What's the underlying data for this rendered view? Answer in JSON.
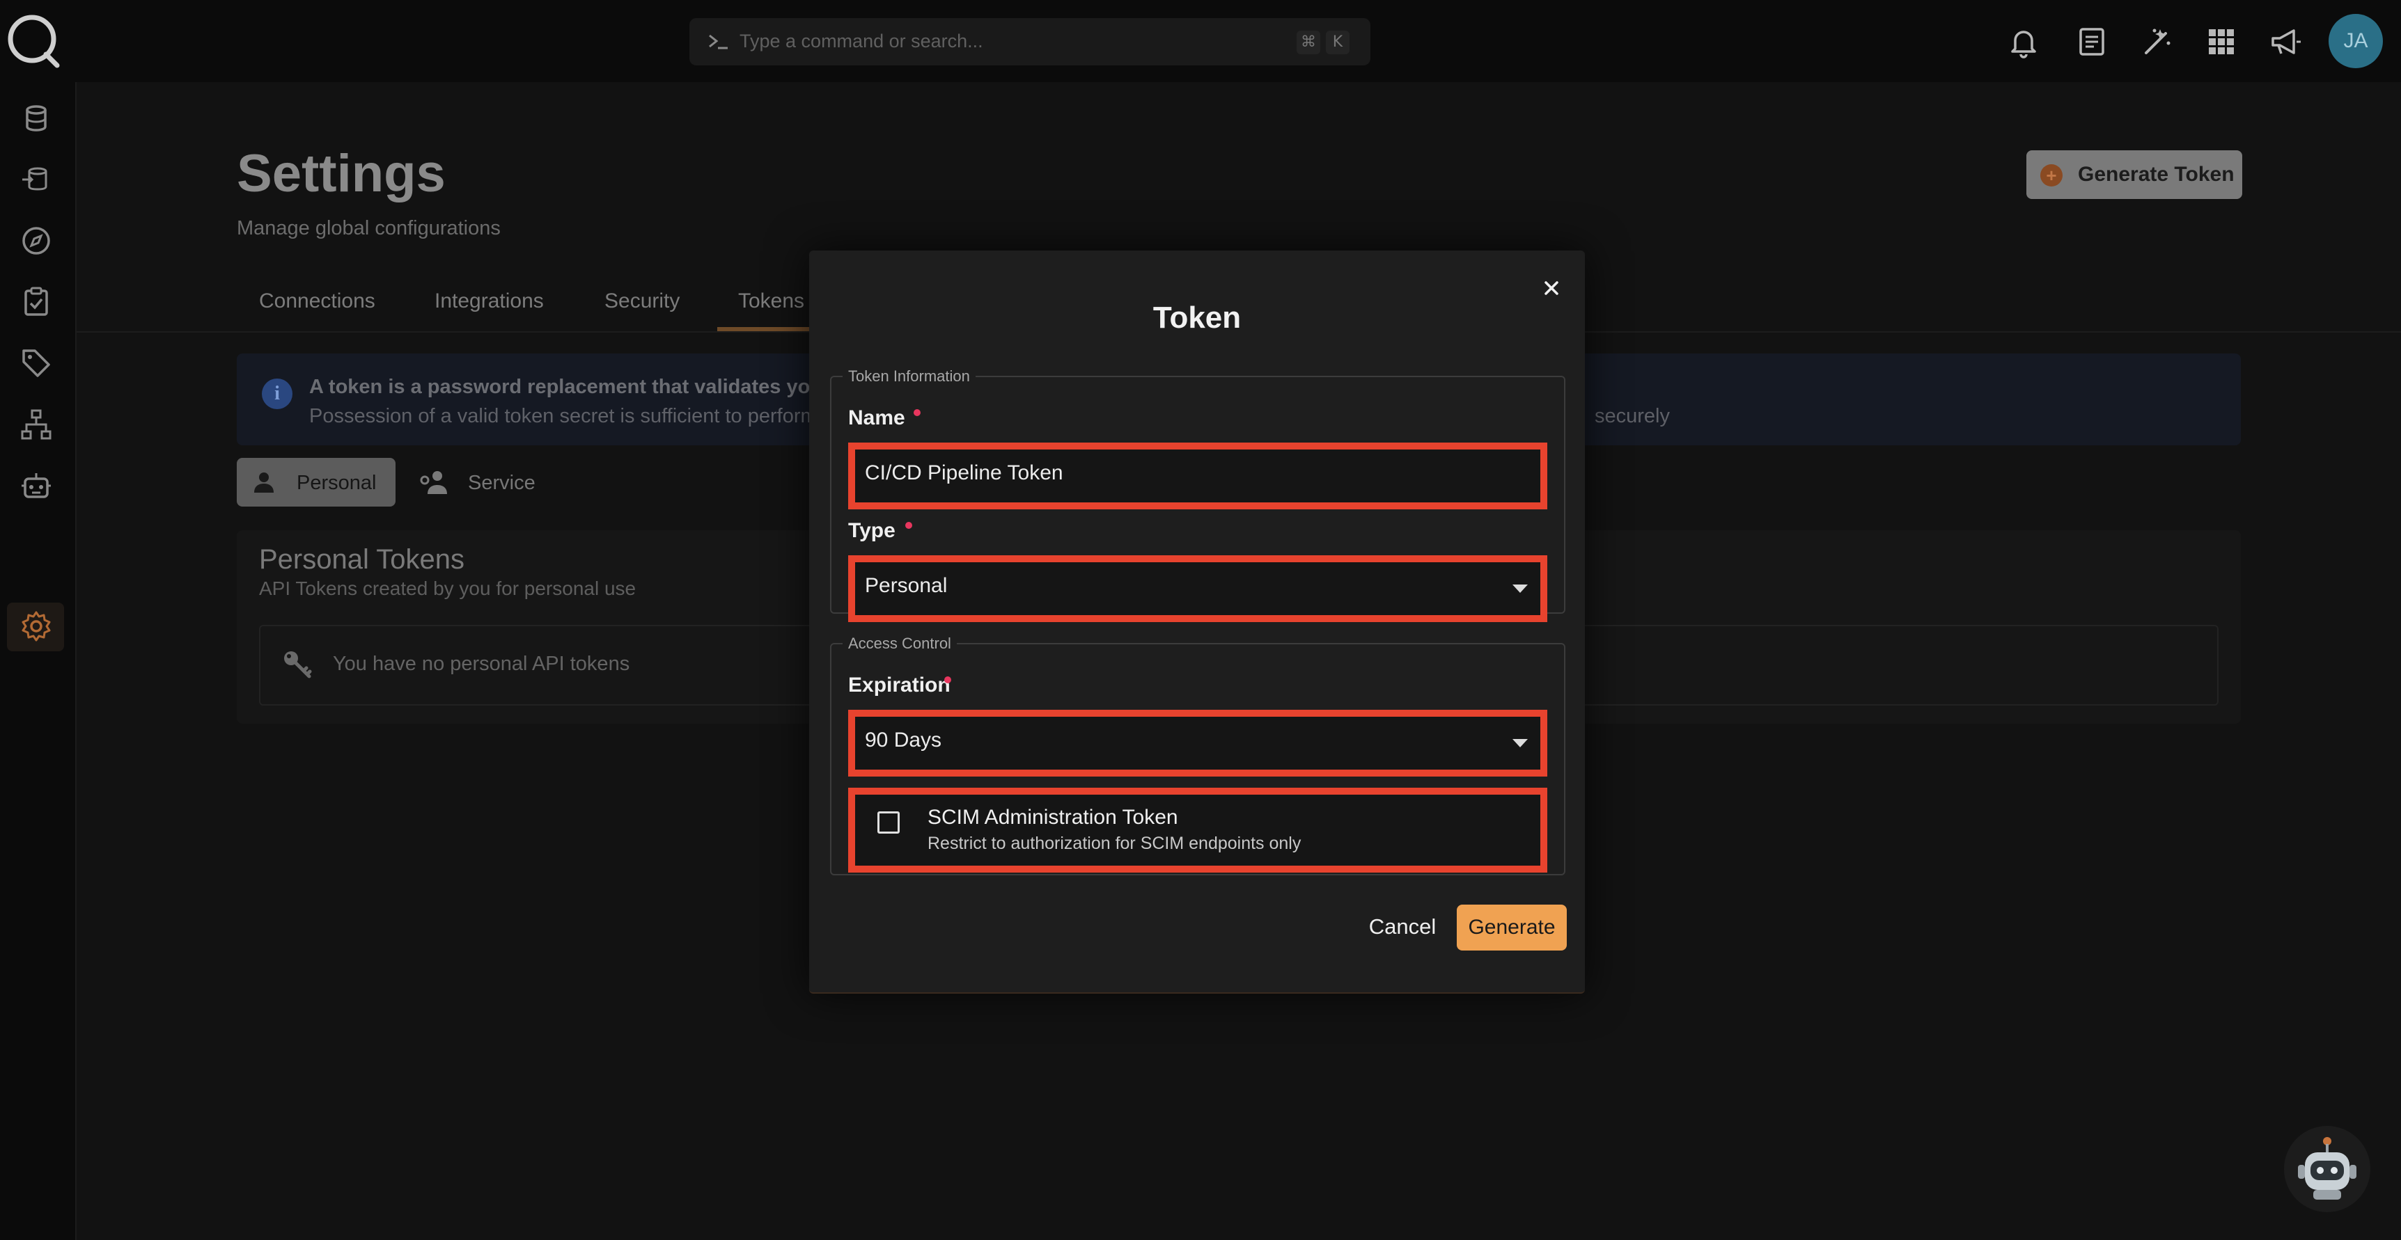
{
  "search": {
    "placeholder": "Type a command or search...",
    "shortcut_keys": [
      "⌘",
      "K"
    ]
  },
  "user": {
    "initials": "JA"
  },
  "page": {
    "title": "Settings",
    "subtitle": "Manage global configurations",
    "generate_token_label": "Generate Token",
    "tabs": [
      "Connections",
      "Integrations",
      "Security",
      "Tokens"
    ],
    "active_tab": "Tokens",
    "info": {
      "line1": "A token is a password replacement that validates you",
      "line2": "Possession of a valid token secret is sufficient to perform",
      "line2_tail": "securely"
    },
    "segments": {
      "personal": "Personal",
      "service": "Service"
    },
    "personal_tokens": {
      "title": "Personal Tokens",
      "subtitle": "API Tokens created by you for personal use",
      "empty": "You have no personal API tokens"
    }
  },
  "modal": {
    "title": "Token",
    "token_info_legend": "Token Information",
    "name_label": "Name",
    "name_value": "CI/CD Pipeline Token",
    "type_label": "Type",
    "type_value": "Personal",
    "access_legend": "Access Control",
    "expiration_label": "Expiration",
    "expiration_value": "90 Days",
    "scim_title": "SCIM Administration Token",
    "scim_desc": "Restrict to authorization for SCIM endpoints only",
    "scim_checked": false,
    "cancel_label": "Cancel",
    "generate_label": "Generate"
  },
  "colors": {
    "accent": "#f0a252",
    "highlight": "#e8432e",
    "required": "#e8365e",
    "avatar": "#2a6f87"
  }
}
